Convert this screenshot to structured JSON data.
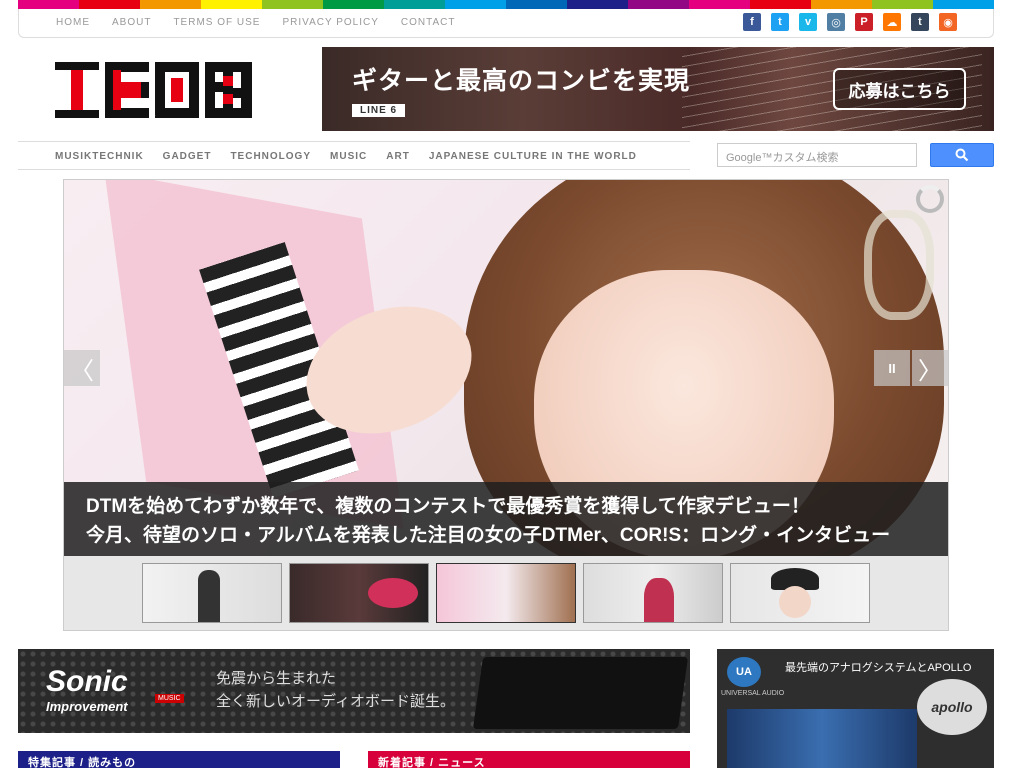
{
  "colors": {
    "rainbow": [
      "#e4007f",
      "#e60012",
      "#f39800",
      "#fff100",
      "#8fc31f",
      "#009944",
      "#009e96",
      "#00a0e9",
      "#0068b7",
      "#1d2088",
      "#920783",
      "#e4007f",
      "#e60012",
      "#f39800",
      "#8fc31f",
      "#00a0e9"
    ],
    "accent_blue": "#4d90fe",
    "logo_red": "#e60012",
    "feature_bar": "#1d2088",
    "news_bar": "#d7003a"
  },
  "top_nav": {
    "links": [
      "HOME",
      "ABOUT",
      "TERMS OF USE",
      "PRIVACY POLICY",
      "CONTACT"
    ],
    "social": [
      {
        "icon": "facebook-icon",
        "glyph": "f",
        "color": "#3b5998"
      },
      {
        "icon": "twitter-icon",
        "glyph": "t",
        "color": "#1da1f2"
      },
      {
        "icon": "vimeo-icon",
        "glyph": "v",
        "color": "#1ab7ea"
      },
      {
        "icon": "instagram-icon",
        "glyph": "◎",
        "color": "#517fa4"
      },
      {
        "icon": "pinterest-icon",
        "glyph": "P",
        "color": "#cb2027"
      },
      {
        "icon": "soundcloud-icon",
        "glyph": "☁",
        "color": "#ff7700"
      },
      {
        "icon": "tumblr-icon",
        "glyph": "t",
        "color": "#35465c"
      },
      {
        "icon": "rss-icon",
        "glyph": "◉",
        "color": "#f26522"
      }
    ]
  },
  "logo": {
    "text": "ICON"
  },
  "banner": {
    "headline": "ギターと最高のコンビを実現",
    "brand": "LINE 6",
    "cta": "応募はこちら"
  },
  "category_nav": {
    "items": [
      "MUSIKTECHNIK",
      "GADGET",
      "TECHNOLOGY",
      "MUSIC",
      "ART",
      "JAPANESE CULTURE IN THE WORLD"
    ]
  },
  "search": {
    "placeholder": "Google™カスタム検索"
  },
  "slider": {
    "caption_line1": "DTMを始めてわずか数年で、複数のコンテストで最優秀賞を獲得して作家デビュー！",
    "caption_line2": "今月、待望のソロ・アルバムを発表した注目の女の子DTMer、COR!S：ロング・インタビュー",
    "prev_glyph": "〈",
    "next_glyph": "〉",
    "pause_glyph": "II",
    "thumb_count": 5,
    "active_thumb": 3
  },
  "ad_left": {
    "brand": "Sonic",
    "brand_sub": "Improvement",
    "brand_tag": "MUSIC",
    "copy_line1": "免震から生まれた",
    "copy_line2": "全く新しいオーディオボード誕生。"
  },
  "ad_right": {
    "title": "最先端のアナログシステムとAPOLLO",
    "ua_logo": "UA",
    "ua_name": "UNIVERSAL AUDIO",
    "product": "apollo"
  },
  "sections": {
    "feature": "特集記事 / 読みもの",
    "news": "新着記事 / ニュース"
  }
}
